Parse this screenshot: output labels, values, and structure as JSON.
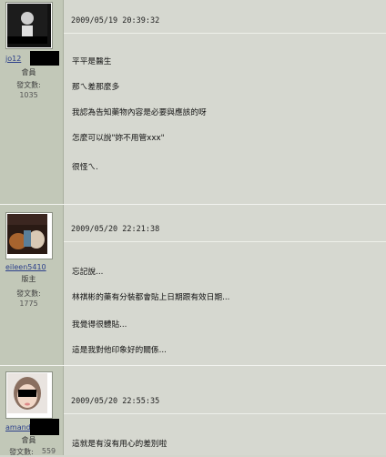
{
  "posts": [
    {
      "username": "jo12",
      "role": "會員",
      "post_count_label": "發文數:",
      "post_count": "1035",
      "date": "2009/05/19 20:39:32",
      "lines": [
        "平平是醫生",
        "那ㄟ差那麼多",
        "我認為告知藥物內容是必要與應該的呀",
        "怎麼可以說\"妳不用管xxx\"",
        "很怪ㄟ."
      ]
    },
    {
      "username": "eileen5410",
      "role": "版主",
      "post_count_label": "發文數:",
      "post_count": "1775",
      "date": "2009/05/20 22:21:38",
      "lines": [
        "忘記說...",
        "林祺彬的藥有分裝都會貼上日期跟有效日期...",
        "我覺得很體貼...",
        "這是我對他印象好的關係..."
      ]
    },
    {
      "username": "amand",
      "role": "會員",
      "post_count_label": "發文數:",
      "post_count": "559",
      "date": "2009/05/20 22:55:35",
      "lines": [
        "這就是有沒有用心的差別啦"
      ]
    }
  ],
  "colors": {
    "sidebar": "#c2c8b8",
    "content": "#d6d8d0",
    "link": "#2b3f8a"
  }
}
